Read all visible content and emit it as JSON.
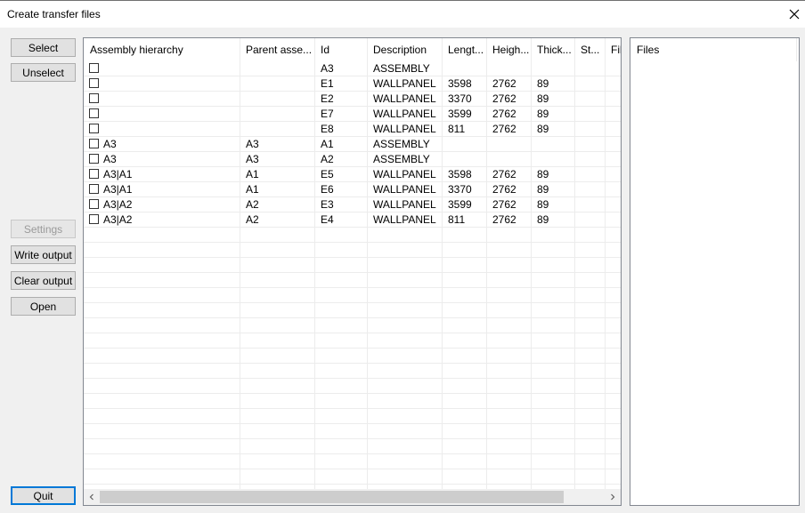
{
  "window": {
    "title": "Create transfer files"
  },
  "buttons": {
    "select": "Select",
    "unselect": "Unselect",
    "settings": "Settings",
    "write_output": "Write output",
    "clear_output": "Clear output",
    "open": "Open",
    "quit": "Quit"
  },
  "table": {
    "columns": [
      "Assembly hierarchy",
      "Parent asse...",
      "Id",
      "Description",
      "Lengt...",
      "Heigh...",
      "Thick...",
      "St...",
      "Fil"
    ],
    "rows": [
      {
        "hierarchy": "",
        "parent": "",
        "id": "A3",
        "description": "ASSEMBLY",
        "length": "",
        "height": "",
        "thickness": "",
        "st": ""
      },
      {
        "hierarchy": "",
        "parent": "",
        "id": "E1",
        "description": "WALLPANEL",
        "length": "3598",
        "height": "2762",
        "thickness": "89",
        "st": ""
      },
      {
        "hierarchy": "",
        "parent": "",
        "id": "E2",
        "description": "WALLPANEL",
        "length": "3370",
        "height": "2762",
        "thickness": "89",
        "st": ""
      },
      {
        "hierarchy": "",
        "parent": "",
        "id": "E7",
        "description": "WALLPANEL",
        "length": "3599",
        "height": "2762",
        "thickness": "89",
        "st": ""
      },
      {
        "hierarchy": "",
        "parent": "",
        "id": "E8",
        "description": "WALLPANEL",
        "length": "811",
        "height": "2762",
        "thickness": "89",
        "st": ""
      },
      {
        "hierarchy": "A3",
        "parent": "A3",
        "id": "A1",
        "description": "ASSEMBLY",
        "length": "",
        "height": "",
        "thickness": "",
        "st": ""
      },
      {
        "hierarchy": "A3",
        "parent": "A3",
        "id": "A2",
        "description": "ASSEMBLY",
        "length": "",
        "height": "",
        "thickness": "",
        "st": ""
      },
      {
        "hierarchy": "A3|A1",
        "parent": "A1",
        "id": "E5",
        "description": "WALLPANEL",
        "length": "3598",
        "height": "2762",
        "thickness": "89",
        "st": ""
      },
      {
        "hierarchy": "A3|A1",
        "parent": "A1",
        "id": "E6",
        "description": "WALLPANEL",
        "length": "3370",
        "height": "2762",
        "thickness": "89",
        "st": ""
      },
      {
        "hierarchy": "A3|A2",
        "parent": "A2",
        "id": "E3",
        "description": "WALLPANEL",
        "length": "3599",
        "height": "2762",
        "thickness": "89",
        "st": ""
      },
      {
        "hierarchy": "A3|A2",
        "parent": "A2",
        "id": "E4",
        "description": "WALLPANEL",
        "length": "811",
        "height": "2762",
        "thickness": "89",
        "st": ""
      }
    ]
  },
  "files_panel": {
    "header": "Files"
  },
  "icons": {
    "close": "close-icon",
    "scroll_left": "chevron-left-icon",
    "scroll_right": "chevron-right-icon"
  }
}
